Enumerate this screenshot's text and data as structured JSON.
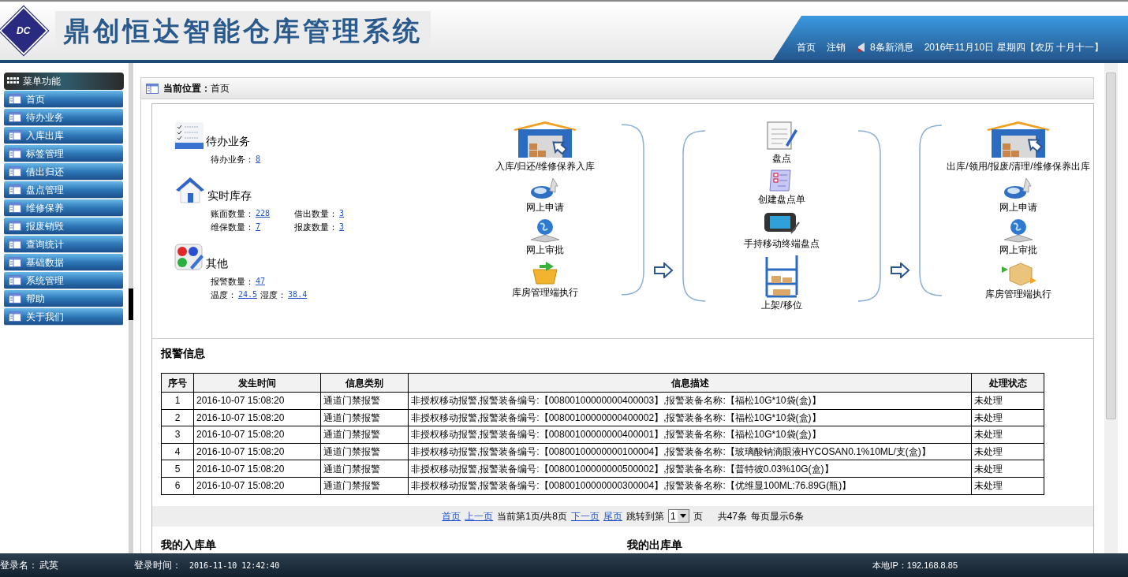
{
  "header": {
    "logo_text": "DC",
    "title": "鼎创恒达智能仓库管理系统",
    "links": [
      "首页",
      "注销"
    ],
    "messages": "8条新消息",
    "date": "2016年11月10日 星期四【农历 十月十一】"
  },
  "sidebar": {
    "title": "菜单功能",
    "items": [
      {
        "label": "首页"
      },
      {
        "label": "待办业务"
      },
      {
        "label": "入库出库"
      },
      {
        "label": "标签管理"
      },
      {
        "label": "借出归还"
      },
      {
        "label": "盘点管理"
      },
      {
        "label": "维修保养"
      },
      {
        "label": "报废销毁"
      },
      {
        "label": "查询统计"
      },
      {
        "label": "基础数据"
      },
      {
        "label": "系统管理"
      },
      {
        "label": "帮助"
      },
      {
        "label": "关于我们"
      }
    ]
  },
  "breadcrumb": {
    "label": "当前位置：",
    "value": "首页"
  },
  "summary": [
    {
      "kind": "tasks",
      "title": "待办业务",
      "rows": [
        [
          {
            "label": "待办业务：",
            "value": "8"
          }
        ]
      ]
    },
    {
      "kind": "stock",
      "title": "实时库存",
      "rows": [
        [
          {
            "label": "账面数量：",
            "value": "228"
          },
          {
            "label": "借出数量：",
            "value": "3"
          }
        ],
        [
          {
            "label": "维保数量：",
            "value": "7"
          },
          {
            "label": "报废数量：",
            "value": "3"
          }
        ]
      ]
    },
    {
      "kind": "other",
      "title": "其他",
      "rows": [
        [
          {
            "label": "报警数量：",
            "value": "47"
          }
        ],
        [
          {
            "label": "温度：",
            "value": "24.5"
          },
          {
            "label": "湿度：",
            "value": "38.4"
          }
        ]
      ]
    }
  ],
  "flow": [
    {
      "bracket_left": false,
      "bracket_right": true,
      "items": [
        {
          "kind": "warehouse_in",
          "label": "入库/归还/维修保养入库"
        },
        {
          "kind": "mouse",
          "label": "网上申请"
        },
        {
          "kind": "globe",
          "label": "网上审批"
        },
        {
          "kind": "basket",
          "label": "库房管理端执行"
        }
      ]
    },
    {
      "bracket_left": true,
      "bracket_right": true,
      "items": [
        {
          "kind": "notepad",
          "label": "盘点"
        },
        {
          "kind": "checklist",
          "label": "创建盘点单"
        },
        {
          "kind": "handheld",
          "label": "手持移动终端盘点"
        },
        {
          "kind": "shelf",
          "label": "上架/移位"
        }
      ]
    },
    {
      "bracket_left": true,
      "bracket_right": false,
      "items": [
        {
          "kind": "warehouse_out",
          "label": "出库/领用/报废/清理/维修保养出库"
        },
        {
          "kind": "mouse",
          "label": "网上申请"
        },
        {
          "kind": "globe",
          "label": "网上审批"
        },
        {
          "kind": "box",
          "label": "库房管理端执行"
        }
      ]
    }
  ],
  "alarms": {
    "title": "报警信息",
    "columns": [
      "序号",
      "发生时间",
      "信息类别",
      "信息描述",
      "处理状态"
    ],
    "rows": [
      [
        "1",
        "2016-10-07 15:08:20",
        "通道门禁报警",
        "非授权移动报警,报警装备编号:【00800100000000400003】,报警装备名称:【福松10G*10袋(盒)】",
        "未处理"
      ],
      [
        "2",
        "2016-10-07 15:08:20",
        "通道门禁报警",
        "非授权移动报警,报警装备编号:【00800100000000400002】,报警装备名称:【福松10G*10袋(盒)】",
        "未处理"
      ],
      [
        "3",
        "2016-10-07 15:08:20",
        "通道门禁报警",
        "非授权移动报警,报警装备编号:【00800100000000400001】,报警装备名称:【福松10G*10袋(盒)】",
        "未处理"
      ],
      [
        "4",
        "2016-10-07 15:08:20",
        "通道门禁报警",
        "非授权移动报警,报警装备编号:【00800100000000100004】,报警装备名称:【玻璃酸钠滴眼液HYCOSAN0.1%10ML/支(盒)】",
        "未处理"
      ],
      [
        "5",
        "2016-10-07 15:08:20",
        "通道门禁报警",
        "非授权移动报警,报警装备编号:【00800100000000500002】,报警装备名称:【普特彼0.03%10G(盒)】",
        "未处理"
      ],
      [
        "6",
        "2016-10-07 15:08:20",
        "通道门禁报警",
        "非授权移动报警,报警装备编号:【00800100000000300004】,报警装备名称:【优维显100ML:76.89G(瓶)】",
        "未处理"
      ]
    ]
  },
  "pagination": {
    "first": "首页",
    "prev": "上一页",
    "current": "当前第1页/共8页",
    "next": "下一页",
    "last": "尾页",
    "jump_label": "跳转到第",
    "page_value": "1",
    "page_unit": "页",
    "total": "共47条",
    "per_page": "每页显示6条"
  },
  "lists": [
    "我的入库单",
    "我的出库单"
  ],
  "status_bar": {
    "user_label": "登录名：",
    "user": "武英",
    "time_label": "登录时间：",
    "time": "2016-11-10 12:42:40",
    "ip": "本地IP：192.168.8.85"
  }
}
